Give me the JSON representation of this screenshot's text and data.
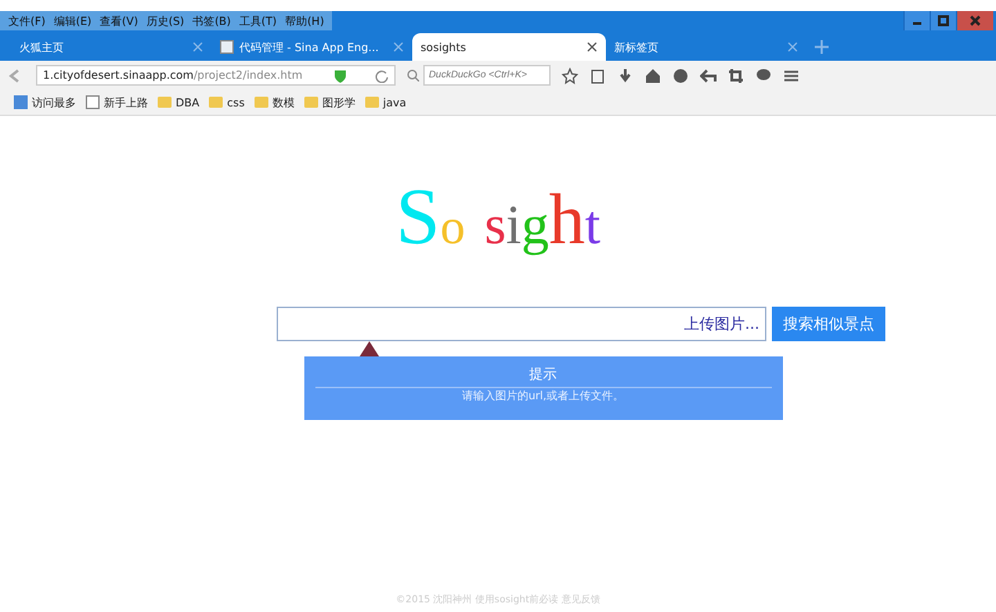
{
  "menu": [
    "文件(F)",
    "编辑(E)",
    "查看(V)",
    "历史(S)",
    "书签(B)",
    "工具(T)",
    "帮助(H)"
  ],
  "tabs": [
    {
      "label": "火狐主页",
      "selected": false,
      "favicon": false
    },
    {
      "label": "代码管理 - Sina App Eng...",
      "selected": false,
      "favicon": true
    },
    {
      "label": "sosights",
      "selected": true,
      "favicon": false
    },
    {
      "label": "新标签页",
      "selected": false,
      "favicon": false
    }
  ],
  "address": {
    "host": "1.cityofdesert.sinaapp.com",
    "path": "/project2/index.htm"
  },
  "search": {
    "placeholder": "DuckDuckGo <Ctrl+K>"
  },
  "bookmarks": [
    {
      "label": "访问最多",
      "kind": "smart"
    },
    {
      "label": "新手上路",
      "kind": "page"
    },
    {
      "label": "DBA",
      "kind": "folder"
    },
    {
      "label": "css",
      "kind": "folder"
    },
    {
      "label": "数模",
      "kind": "folder"
    },
    {
      "label": "图形学",
      "kind": "folder"
    },
    {
      "label": "java",
      "kind": "folder"
    }
  ],
  "logo": [
    {
      "letters": [
        {
          "char": "S",
          "color": "#00e8f0"
        },
        {
          "char": "o",
          "color": "#f5c02a"
        }
      ]
    },
    {
      "letters": [
        {
          "char": "s",
          "color": "#e8304a"
        },
        {
          "char": "i",
          "color": "#707070"
        },
        {
          "char": "g",
          "color": "#22c21a"
        },
        {
          "char": "h",
          "color": "#e83a2a"
        },
        {
          "char": "t",
          "color": "#7a3ae8"
        }
      ]
    }
  ],
  "upload_link": "上传图片...",
  "search_button": "搜索相似景点",
  "tooltip": {
    "title": "提示",
    "message": "请输入图片的url,或者上传文件。"
  },
  "footer": "©2015 沈阳神州 使用sosight前必读 意见反馈"
}
